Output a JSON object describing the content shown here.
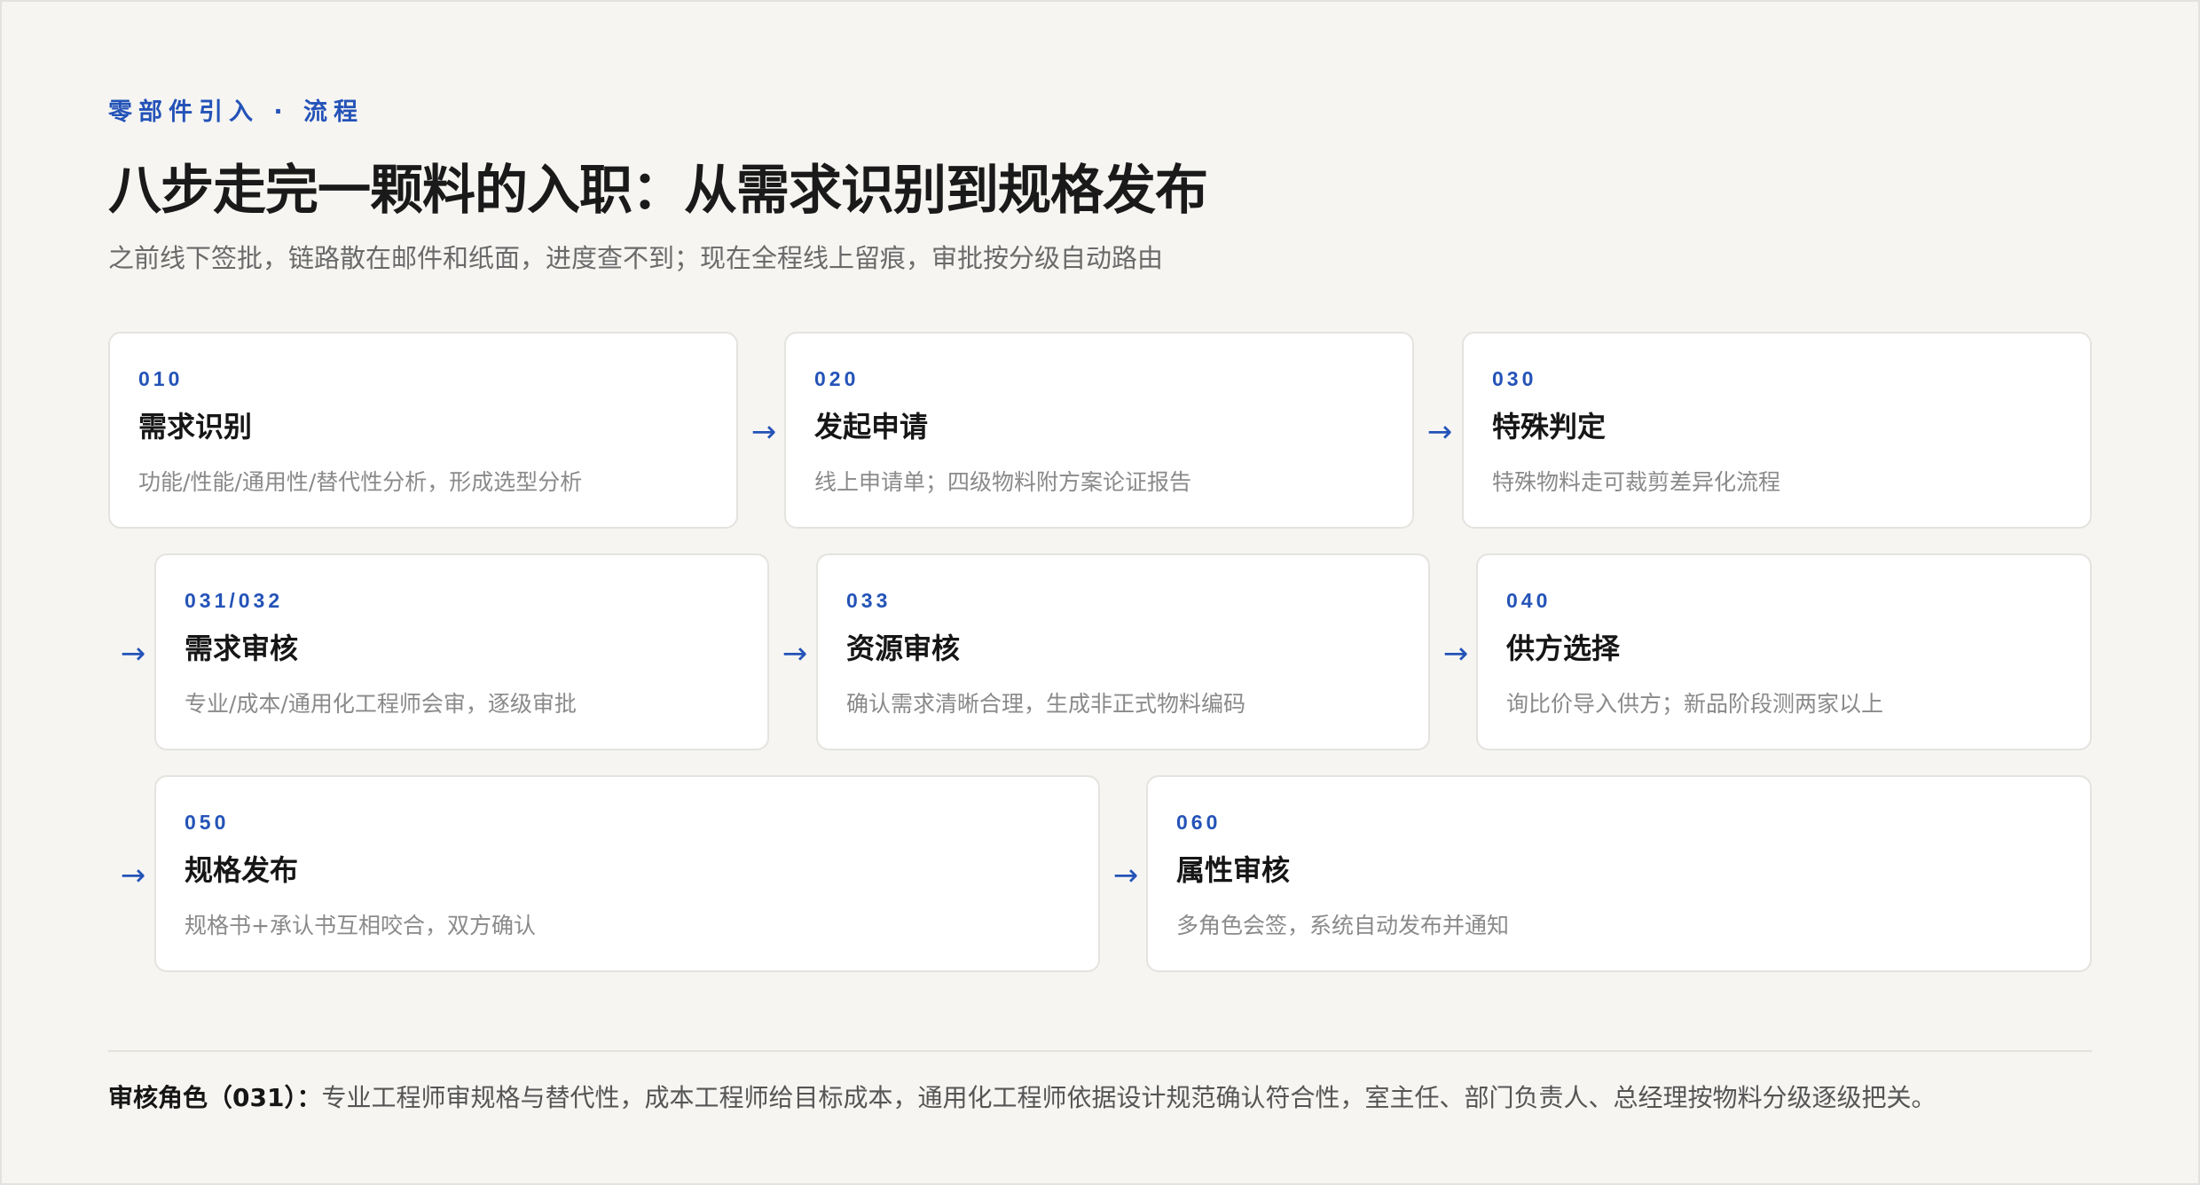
{
  "header": {
    "eyebrow": "零部件引入 · 流程",
    "title": "八步走完一颗料的入职：从需求识别到规格发布",
    "subtitle": "之前线下签批，链路散在邮件和纸面，进度查不到；现在全程线上留痕，审批按分级自动路由"
  },
  "steps": [
    {
      "code": "010",
      "name": "需求识别",
      "desc": "功能/性能/通用性/替代性分析，形成选型分析"
    },
    {
      "code": "020",
      "name": "发起申请",
      "desc": "线上申请单；四级物料附方案论证报告"
    },
    {
      "code": "030",
      "name": "特殊判定",
      "desc": "特殊物料走可裁剪差异化流程"
    },
    {
      "code": "031/032",
      "name": "需求审核",
      "desc": "专业/成本/通用化工程师会审，逐级审批"
    },
    {
      "code": "033",
      "name": "资源审核",
      "desc": "确认需求清晰合理，生成非正式物料编码"
    },
    {
      "code": "040",
      "name": "供方选择",
      "desc": "询比价导入供方；新品阶段测两家以上"
    },
    {
      "code": "050",
      "name": "规格发布",
      "desc": "规格书+承认书互相咬合，双方确认"
    },
    {
      "code": "060",
      "name": "属性审核",
      "desc": "多角色会签，系统自动发布并通知"
    }
  ],
  "arrows": [
    "→",
    "→",
    "→",
    "→",
    "→",
    "→",
    "→"
  ],
  "footer": {
    "lead": "审核角色（031）：",
    "text": "专业工程师审规格与替代性，成本工程师给目标成本，通用化工程师依据设计规范确认符合性，室主任、部门负责人、总经理按物料分级逐级把关。"
  },
  "colors": {
    "accent": "#2453b8",
    "background": "#f6f5f2",
    "card": "#ffffff"
  }
}
